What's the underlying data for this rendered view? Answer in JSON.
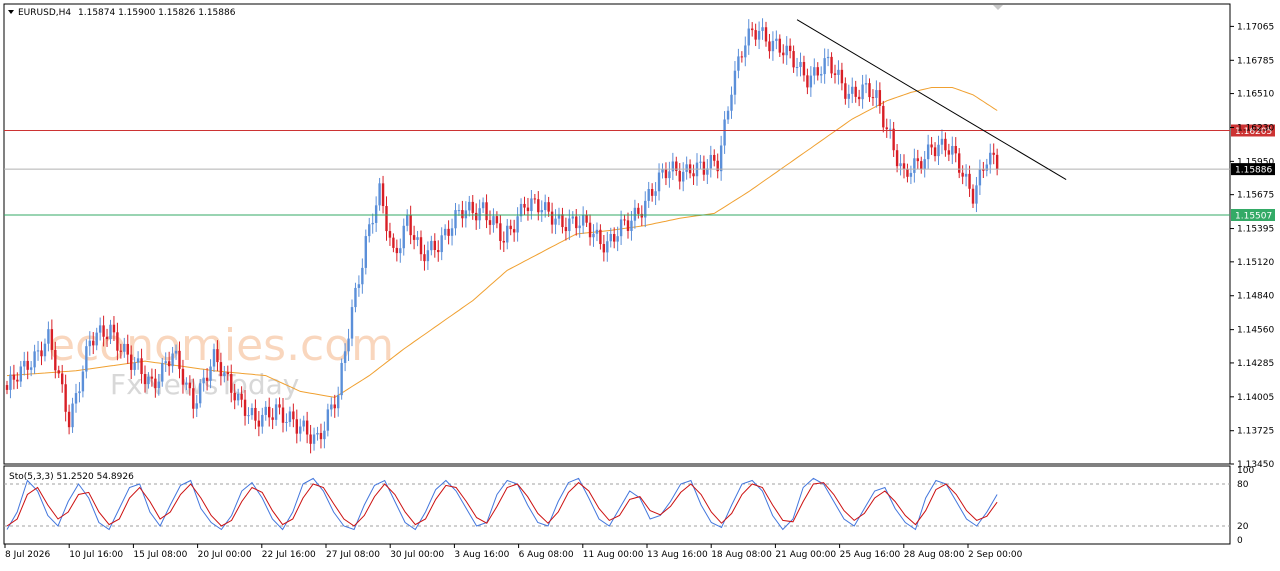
{
  "header": {
    "symbol": "EURUSD,H4",
    "ohlc": "1.15874 1.15900 1.15826 1.15886"
  },
  "watermark": {
    "line1": "economies.com",
    "line2": "FxNewsToday"
  },
  "colors": {
    "bull": "#5b8fd9",
    "bear": "#d81f26",
    "ma": "#f0a030",
    "resistance": "#cc3333",
    "support": "#33aa66",
    "current": "#b0b0b0",
    "trendline": "#000000",
    "stoch_main": "#4477dd",
    "stoch_signal": "#cc1111"
  },
  "chart_data": [
    {
      "type": "candlestick",
      "name": "main",
      "y_ticks": [
        "1.17065",
        "1.16785",
        "1.16510",
        "1.16230",
        "1.15950",
        "1.15675",
        "1.15395",
        "1.15120",
        "1.14840",
        "1.14560",
        "1.14285",
        "1.14005",
        "1.13725",
        "1.13450"
      ],
      "ylim": [
        1.1345,
        1.1725
      ],
      "x_labels": [
        "8 Jul 2026",
        "10 Jul 16:00",
        "15 Jul 08:00",
        "20 Jul 00:00",
        "22 Jul 16:00",
        "27 Jul 08:00",
        "30 Jul 00:00",
        "3 Aug 16:00",
        "6 Aug 08:00",
        "11 Aug 00:00",
        "13 Aug 16:00",
        "18 Aug 08:00",
        "21 Aug 00:00",
        "25 Aug 16:00",
        "28 Aug 08:00",
        "2 Sep 00:00"
      ],
      "anchors": [
        [
          0,
          1.1402
        ],
        [
          6,
          1.1432
        ],
        [
          12,
          1.1445
        ],
        [
          18,
          1.1385
        ],
        [
          24,
          1.1442
        ],
        [
          30,
          1.146
        ],
        [
          36,
          1.1425
        ],
        [
          42,
          1.1415
        ],
        [
          48,
          1.1432
        ],
        [
          54,
          1.14
        ],
        [
          60,
          1.1428
        ],
        [
          66,
          1.1408
        ],
        [
          72,
          1.1375
        ],
        [
          78,
          1.1395
        ],
        [
          84,
          1.1372
        ],
        [
          90,
          1.137
        ],
        [
          96,
          1.1398
        ],
        [
          100,
          1.1475
        ],
        [
          104,
          1.153
        ],
        [
          108,
          1.1565
        ],
        [
          112,
          1.152
        ],
        [
          116,
          1.1548
        ],
        [
          120,
          1.1512
        ],
        [
          126,
          1.1535
        ],
        [
          132,
          1.155
        ],
        [
          138,
          1.156
        ],
        [
          144,
          1.1525
        ],
        [
          150,
          1.1565
        ],
        [
          156,
          1.155
        ],
        [
          162,
          1.1548
        ],
        [
          168,
          1.1538
        ],
        [
          174,
          1.153
        ],
        [
          180,
          1.154
        ],
        [
          186,
          1.157
        ],
        [
          192,
          1.1585
        ],
        [
          198,
          1.1592
        ],
        [
          202,
          1.1585
        ],
        [
          206,
          1.1595
        ],
        [
          210,
          1.166
        ],
        [
          214,
          1.169
        ],
        [
          218,
          1.1705
        ],
        [
          222,
          1.1695
        ],
        [
          226,
          1.168
        ],
        [
          232,
          1.1668
        ],
        [
          238,
          1.1672
        ],
        [
          244,
          1.1655
        ],
        [
          248,
          1.1652
        ],
        [
          252,
          1.1645
        ],
        [
          256,
          1.162
        ],
        [
          260,
          1.158
        ],
        [
          264,
          1.159
        ],
        [
          268,
          1.1612
        ],
        [
          272,
          1.1605
        ],
        [
          276,
          1.159
        ],
        [
          280,
          1.1572
        ],
        [
          284,
          1.1595
        ],
        [
          287,
          1.15886
        ]
      ],
      "moving_average": [
        [
          0,
          1.1418
        ],
        [
          20,
          1.1422
        ],
        [
          40,
          1.143
        ],
        [
          60,
          1.1422
        ],
        [
          75,
          1.1418
        ],
        [
          85,
          1.1405
        ],
        [
          95,
          1.14
        ],
        [
          105,
          1.1418
        ],
        [
          115,
          1.144
        ],
        [
          125,
          1.146
        ],
        [
          135,
          1.148
        ],
        [
          145,
          1.1505
        ],
        [
          155,
          1.152
        ],
        [
          165,
          1.1535
        ],
        [
          175,
          1.1538
        ],
        [
          185,
          1.1542
        ],
        [
          195,
          1.1548
        ],
        [
          205,
          1.1552
        ],
        [
          215,
          1.157
        ],
        [
          225,
          1.159
        ],
        [
          235,
          1.161
        ],
        [
          245,
          1.163
        ],
        [
          255,
          1.1645
        ],
        [
          262,
          1.1652
        ],
        [
          268,
          1.1656
        ],
        [
          274,
          1.1656
        ],
        [
          280,
          1.165
        ],
        [
          287,
          1.1637
        ]
      ],
      "levels": {
        "resistance": {
          "value": 1.16205,
          "label": "1.16205"
        },
        "support": {
          "value": 1.15507,
          "label": "1.15507"
        },
        "current": {
          "value": 1.15886,
          "label": "1.15886"
        }
      },
      "trendline": [
        [
          229,
          1.1712
        ],
        [
          307,
          1.158
        ]
      ]
    },
    {
      "type": "line",
      "name": "stochastic",
      "title": "Sto(5,3,3) 51.2520 54.8926",
      "y_ticks": [
        "100",
        "80",
        "20",
        "0"
      ],
      "ylim": [
        0,
        100
      ],
      "levels": [
        80,
        20
      ],
      "series": [
        {
          "role": "main",
          "values": [
            15,
            40,
            85,
            70,
            35,
            20,
            55,
            80,
            60,
            25,
            15,
            45,
            75,
            80,
            40,
            20,
            50,
            78,
            85,
            45,
            25,
            15,
            35,
            70,
            82,
            60,
            30,
            15,
            40,
            80,
            88,
            70,
            40,
            20,
            15,
            50,
            78,
            85,
            55,
            25,
            15,
            40,
            72,
            85,
            70,
            45,
            20,
            25,
            65,
            85,
            80,
            50,
            25,
            20,
            55,
            82,
            88,
            60,
            30,
            20,
            45,
            70,
            60,
            30,
            35,
            55,
            80,
            85,
            50,
            25,
            18,
            50,
            80,
            85,
            70,
            35,
            15,
            30,
            75,
            88,
            80,
            55,
            30,
            20,
            45,
            70,
            75,
            45,
            25,
            15,
            60,
            85,
            80,
            55,
            30,
            20,
            40,
            65
          ]
        },
        {
          "role": "signal",
          "values": [
            20,
            30,
            65,
            75,
            50,
            30,
            40,
            65,
            68,
            40,
            22,
            30,
            60,
            75,
            55,
            30,
            40,
            65,
            80,
            60,
            35,
            20,
            28,
            55,
            75,
            68,
            42,
            22,
            30,
            60,
            80,
            75,
            52,
            30,
            20,
            35,
            62,
            80,
            65,
            40,
            22,
            30,
            58,
            78,
            75,
            55,
            32,
            24,
            48,
            75,
            80,
            62,
            38,
            24,
            40,
            68,
            82,
            70,
            45,
            28,
            35,
            58,
            62,
            42,
            36,
            48,
            68,
            80,
            65,
            40,
            24,
            38,
            65,
            80,
            75,
            50,
            28,
            26,
            55,
            80,
            82,
            65,
            42,
            28,
            38,
            60,
            70,
            55,
            35,
            22,
            42,
            72,
            80,
            65,
            42,
            28,
            34,
            54
          ]
        }
      ]
    }
  ]
}
